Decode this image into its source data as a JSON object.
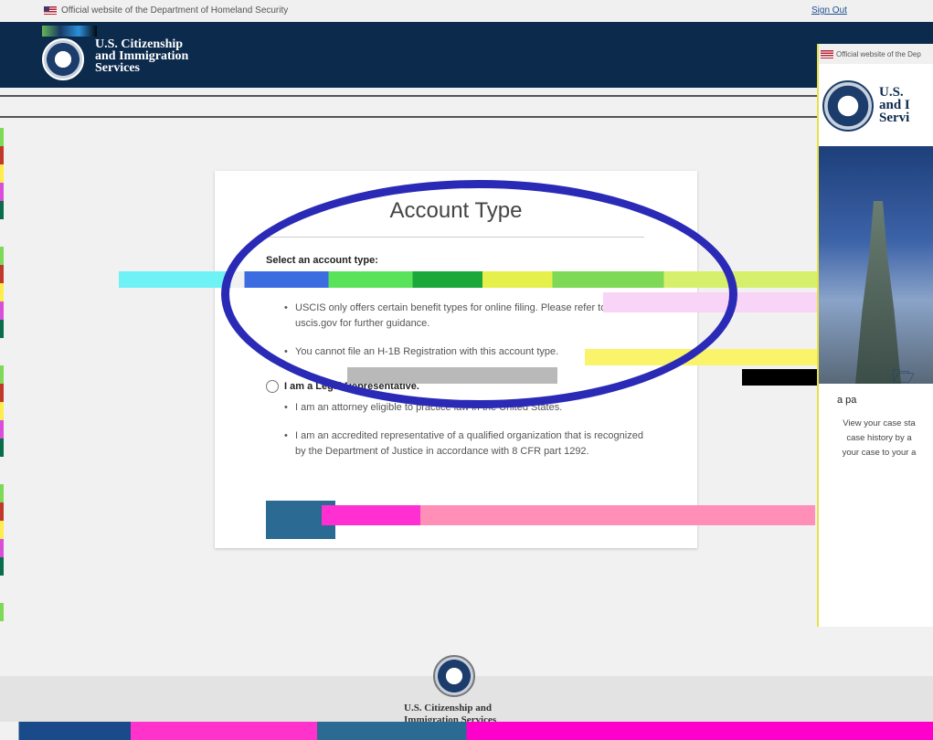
{
  "banner": {
    "official_text": "Official website of the Department of Homeland Security",
    "sign_out": "Sign Out"
  },
  "header": {
    "brand_line1": "U.S. Citizenship",
    "brand_line2": "and Immigration",
    "brand_line3": "Services"
  },
  "main": {
    "title": "Account Type",
    "prompt": "Select an account type:",
    "options": [
      {
        "label": "",
        "bullets": [
          "USCIS only offers certain benefit types for online filing. Please refer to uscis.gov for further guidance.",
          "You cannot file an H-1B Registration with this account type."
        ]
      },
      {
        "label": "I am a Legal Representative.",
        "bullets": [
          "I am an attorney eligible to practice law in the United States.",
          "I am an accredited representative of a qualified organization that is recognized by the Department of Justice in accordance with 8 CFR part 1292."
        ]
      }
    ],
    "continue_label": ""
  },
  "popup": {
    "official_text": "Official website of the Dep",
    "brand_line1": "U.S.",
    "brand_line2": "and I",
    "brand_line3": "Servi",
    "card_label": "a pa",
    "card_text_line1": "View your case sta",
    "card_text_line2": "case history by a",
    "card_text_line3": "your case to your a"
  },
  "footer": {
    "agency_line1": "U.S. Citizenship and",
    "agency_line2": "Immigration Services"
  },
  "colors": {
    "header_bg": "#0b2a4c",
    "button_bg": "#2a6a93",
    "annotation_ellipse": "#2a2ab7"
  },
  "icons": {
    "flag": "us-flag-icon",
    "seal": "dhs-seal-icon",
    "folder": "folder-icon"
  }
}
